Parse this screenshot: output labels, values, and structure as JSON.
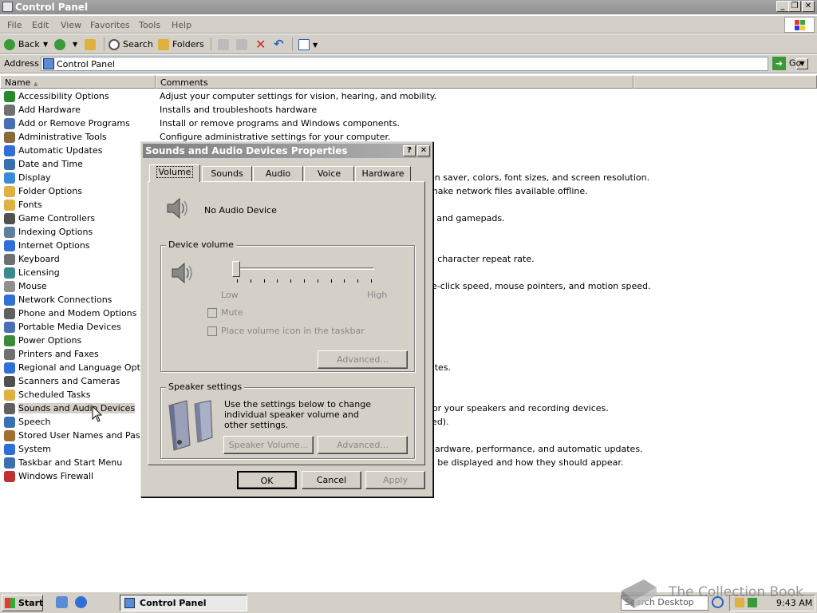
{
  "window": {
    "title": "Control Panel"
  },
  "menu": [
    "File",
    "Edit",
    "View",
    "Favorites",
    "Tools",
    "Help"
  ],
  "toolbar": {
    "back": "Back",
    "search": "Search",
    "folders": "Folders"
  },
  "address": {
    "label": "Address",
    "value": "Control Panel",
    "go": "Go"
  },
  "columns": {
    "name": "Name",
    "comments": "Comments"
  },
  "items": [
    {
      "name": "Accessibility Options",
      "comment": "Adjust your computer settings for vision, hearing, and mobility.",
      "color": "#2a8a2a"
    },
    {
      "name": "Add Hardware",
      "comment": "Installs and troubleshoots hardware",
      "color": "#707070"
    },
    {
      "name": "Add or Remove Programs",
      "comment": "Install or remove programs and Windows components.",
      "color": "#4a6fb5"
    },
    {
      "name": "Administrative Tools",
      "comment": "Configure administrative settings for your computer.",
      "color": "#8a6a3a"
    },
    {
      "name": "Automatic Updates",
      "comment": "",
      "color": "#2f6fd6"
    },
    {
      "name": "Date and Time",
      "comment": "",
      "color": "#3a6fb0"
    },
    {
      "name": "Display",
      "comment": "en saver, colors, font sizes, and screen resolution.",
      "color": "#3a8ad6"
    },
    {
      "name": "Folder Options",
      "comment": "make network files available offline.",
      "color": "#e0b040"
    },
    {
      "name": "Fonts",
      "comment": "",
      "color": "#e0b040"
    },
    {
      "name": "Game Controllers",
      "comment": "s and gamepads.",
      "color": "#505050"
    },
    {
      "name": "Indexing Options",
      "comment": "",
      "color": "#6080a0"
    },
    {
      "name": "Internet Options",
      "comment": "",
      "color": "#2f6fd6"
    },
    {
      "name": "Keyboard",
      "comment": "e character repeat rate.",
      "color": "#707070"
    },
    {
      "name": "Licensing",
      "comment": "",
      "color": "#3a8a8a"
    },
    {
      "name": "Mouse",
      "comment": "le-click speed, mouse pointers, and motion speed.",
      "color": "#909090"
    },
    {
      "name": "Network Connections",
      "comment": "",
      "color": "#2f6fd6"
    },
    {
      "name": "Phone and Modem Options",
      "comment": "",
      "color": "#606060"
    },
    {
      "name": "Portable Media Devices",
      "comment": "",
      "color": "#4a6fb5"
    },
    {
      "name": "Power Options",
      "comment": "",
      "color": "#3a8a3a"
    },
    {
      "name": "Printers and Faxes",
      "comment": "",
      "color": "#707070"
    },
    {
      "name": "Regional and Language Options",
      "comment": "ates.",
      "color": "#2f6fd6"
    },
    {
      "name": "Scanners and Cameras",
      "comment": "",
      "color": "#505050"
    },
    {
      "name": "Scheduled Tasks",
      "comment": "",
      "color": "#e0b040"
    },
    {
      "name": "Sounds and Audio Devices",
      "comment": "for your speakers and recording devices.",
      "color": "#606060"
    },
    {
      "name": "Speech",
      "comment": "led).",
      "color": "#3a6fb0"
    },
    {
      "name": "Stored User Names and Passwords",
      "comment": "",
      "color": "#a07030"
    },
    {
      "name": "System",
      "comment": "hardware, performance, and automatic updates.",
      "color": "#2f6fd6"
    },
    {
      "name": "Taskbar and Start Menu",
      "comment": "o be displayed and how they should appear.",
      "color": "#3a6fb0"
    },
    {
      "name": "Windows Firewall",
      "comment": "",
      "color": "#c03030"
    }
  ],
  "dialog": {
    "title": "Sounds and Audio Devices Properties",
    "help_btn": "?",
    "close_btn": "✕",
    "tabs": [
      "Volume",
      "Sounds",
      "Audio",
      "Voice",
      "Hardware"
    ],
    "device_name": "No Audio Device",
    "device_volume": {
      "label": "Device volume",
      "low": "Low",
      "high": "High",
      "level": 0,
      "mute": "Mute",
      "place_icon": "Place volume icon in the taskbar",
      "advanced": "Advanced..."
    },
    "speaker_settings": {
      "label": "Speaker settings",
      "description": "Use the settings below to change individual speaker volume and other settings.",
      "speaker_volume": "Speaker Volume...",
      "advanced": "Advanced..."
    },
    "ok": "OK",
    "cancel": "Cancel",
    "apply": "Apply"
  },
  "taskbar": {
    "start": "Start",
    "task": "Control Panel",
    "search": "Search Desktop",
    "time": "9:43 AM"
  },
  "watermark": "The Collection Book"
}
